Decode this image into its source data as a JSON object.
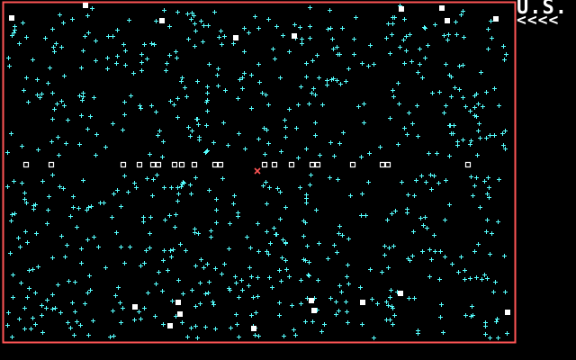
{
  "hud": {
    "title": "U.S.",
    "lives_glyphs": "<<<<"
  },
  "colors": {
    "background": "#000000",
    "border": "#ff5555",
    "stars": "#55ffff",
    "blocks": "#ffffff",
    "target": "#ff5555"
  },
  "icons": {
    "star": "plus-mark-icon",
    "block": "white-square-icon",
    "ring": "hollow-square-icon",
    "player": "red-x-icon"
  }
}
